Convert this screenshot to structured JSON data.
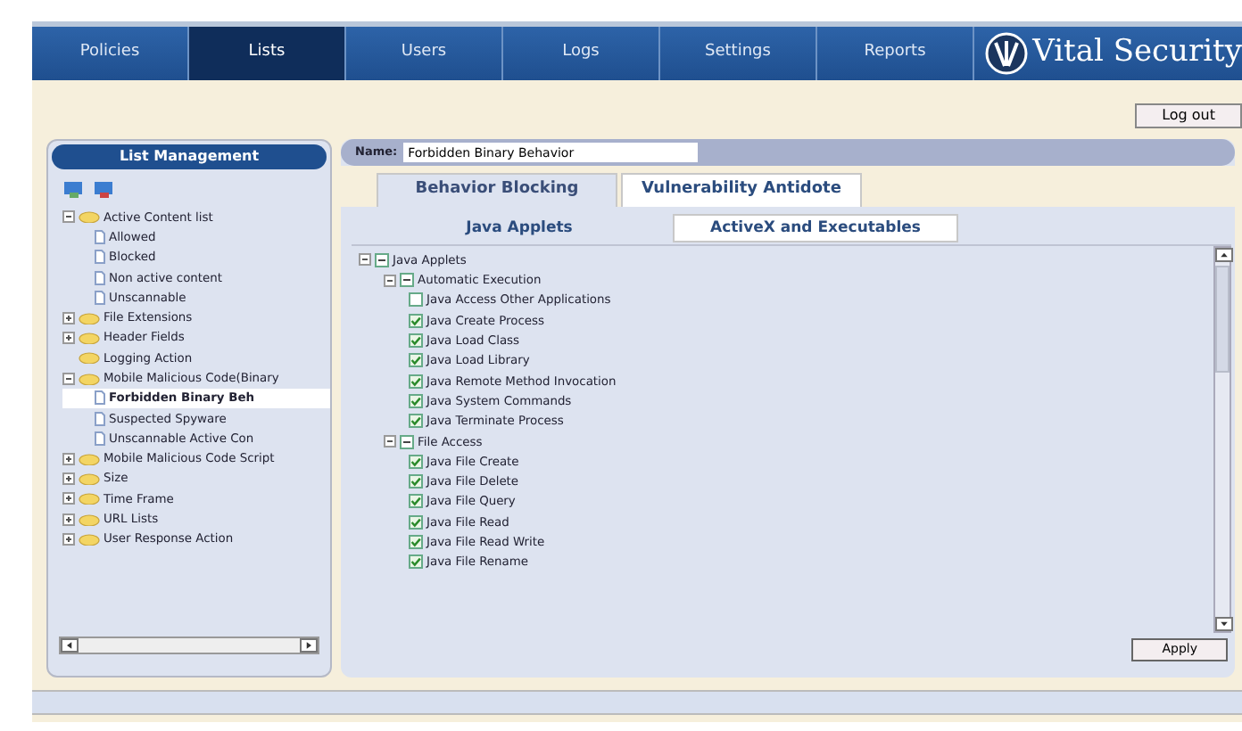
{
  "nav": {
    "tabs": [
      {
        "label": "Policies",
        "selected": false
      },
      {
        "label": "Lists",
        "selected": true
      },
      {
        "label": "Users",
        "selected": false
      },
      {
        "label": "Logs",
        "selected": false
      },
      {
        "label": "Settings",
        "selected": false
      },
      {
        "label": "Reports",
        "selected": false
      }
    ],
    "brand": "Vital Security"
  },
  "logout": "Log out",
  "sidebar": {
    "title": "List Management",
    "tree": [
      {
        "label": "Active Content list",
        "expanded": true,
        "selected": false,
        "children": [
          {
            "label": "Allowed",
            "selected": false
          },
          {
            "label": "Blocked",
            "selected": false
          },
          {
            "label": "Non active content",
            "selected": false
          },
          {
            "label": "Unscannable",
            "selected": false
          }
        ]
      },
      {
        "label": "File Extensions",
        "expanded": false,
        "selected": false
      },
      {
        "label": "Header Fields",
        "expanded": false,
        "selected": false
      },
      {
        "label": "Logging Action",
        "selected": false
      },
      {
        "label": "Mobile Malicious Code(Binary",
        "expanded": true,
        "selected": false,
        "children": [
          {
            "label": "Forbidden Binary Beh",
            "selected": true
          },
          {
            "label": "Suspected Spyware",
            "selected": false
          },
          {
            "label": "Unscannable Active Con",
            "selected": false
          }
        ]
      },
      {
        "label": "Mobile Malicious Code Script",
        "expanded": false,
        "selected": false
      },
      {
        "label": "Size",
        "expanded": false,
        "selected": false
      },
      {
        "label": "Time Frame",
        "expanded": false,
        "selected": false
      },
      {
        "label": "URL Lists",
        "expanded": false,
        "selected": false
      },
      {
        "label": "User Response Action",
        "expanded": false,
        "selected": false
      }
    ]
  },
  "name_field": {
    "label": "Name:",
    "value": "Forbidden Binary Behavior"
  },
  "tabs": [
    {
      "label": "Behavior Blocking",
      "selected": true
    },
    {
      "label": "Vulnerability Antidote",
      "selected": false
    }
  ],
  "subtabs": [
    {
      "label": "Java Applets",
      "selected": true
    },
    {
      "label": "ActiveX and Executables",
      "selected": false
    }
  ],
  "rules": [
    {
      "label": "Java Applets",
      "kind": "group",
      "expanded": true,
      "partial": true,
      "children": [
        {
          "label": "Automatic Execution",
          "kind": "group",
          "expanded": true,
          "partial": true,
          "children": [
            {
              "label": "Java Access Other Applications",
              "kind": "item",
              "checked": false
            },
            {
              "label": "Java Create Process",
              "kind": "item",
              "checked": true
            },
            {
              "label": "Java Load Class",
              "kind": "item",
              "checked": true
            },
            {
              "label": "Java Load Library",
              "kind": "item",
              "checked": true
            },
            {
              "label": "Java Remote Method Invocation",
              "kind": "item",
              "checked": true
            },
            {
              "label": "Java System Commands",
              "kind": "item",
              "checked": true
            },
            {
              "label": "Java Terminate Process",
              "kind": "item",
              "checked": true
            }
          ]
        },
        {
          "label": "File Access",
          "kind": "group",
          "expanded": true,
          "partial": true,
          "children": [
            {
              "label": "Java File Create",
              "kind": "item",
              "checked": true
            },
            {
              "label": "Java File Delete",
              "kind": "item",
              "checked": true
            },
            {
              "label": "Java File Query",
              "kind": "item",
              "checked": true
            },
            {
              "label": "Java File Read",
              "kind": "item",
              "checked": true
            },
            {
              "label": "Java File Read Write",
              "kind": "item",
              "checked": true
            },
            {
              "label": "Java File Rename",
              "kind": "item",
              "checked": true
            }
          ]
        }
      ]
    }
  ],
  "apply": "Apply"
}
